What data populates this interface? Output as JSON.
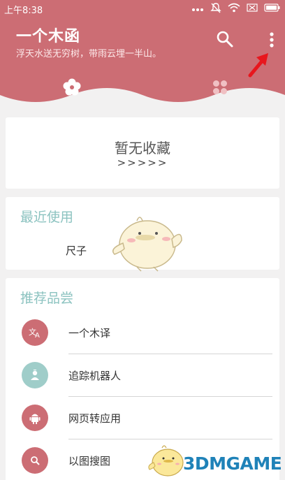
{
  "status_bar": {
    "time": "上午8:38",
    "icons": [
      "dots-icon",
      "mute-icon",
      "wifi-icon",
      "no-sim-icon",
      "battery-icon"
    ]
  },
  "header": {
    "title": "一个木函",
    "subtitle": "浮天水送无穷树，带雨云埋一半山。",
    "color": "#cc6d74"
  },
  "favorites": {
    "title": "暂无收藏",
    "subtitle": ">>>>>"
  },
  "recent": {
    "title": "最近使用",
    "items": [
      "尺子"
    ]
  },
  "recommended": {
    "title": "推荐品尝",
    "items": [
      {
        "label": "一个木译",
        "icon": "translate-icon",
        "color": "#cc6d74"
      },
      {
        "label": "追踪机器人",
        "icon": "person-icon",
        "color": "#9fcdc9"
      },
      {
        "label": "网页转应用",
        "icon": "android-icon",
        "color": "#cc6d74"
      },
      {
        "label": "以图搜图",
        "icon": "search-icon",
        "color": "#cc6d74"
      }
    ]
  },
  "watermark": {
    "text": "3DMGAME"
  }
}
